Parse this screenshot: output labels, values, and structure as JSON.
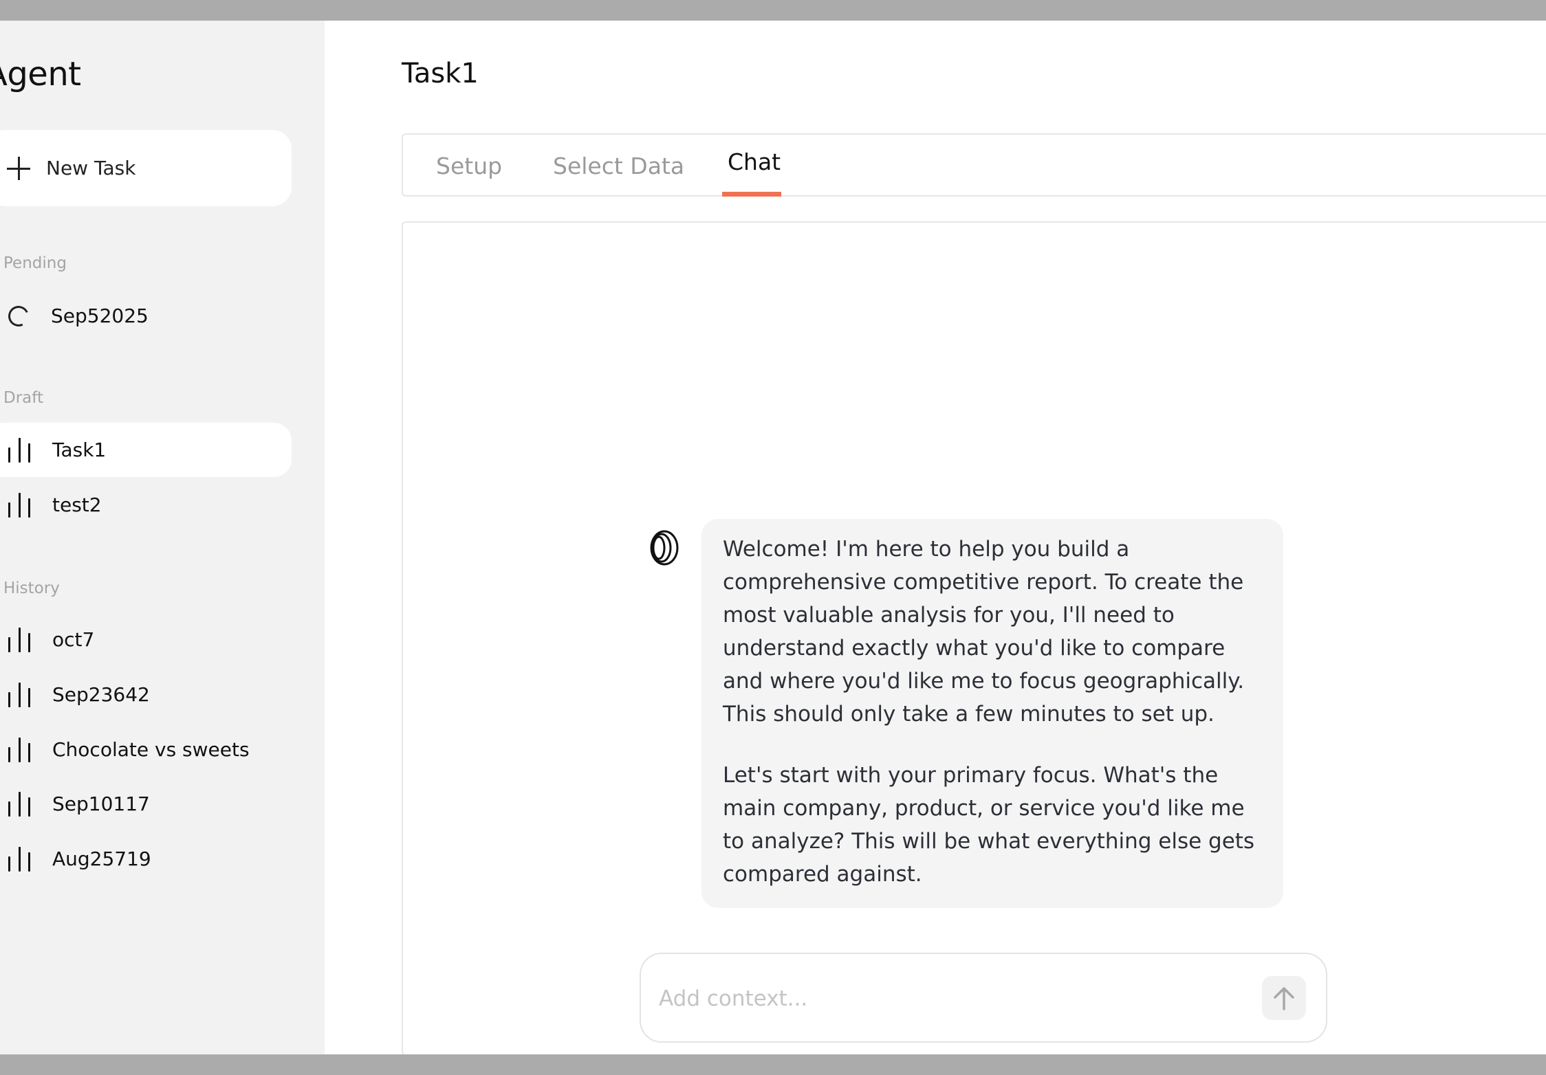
{
  "sidebar": {
    "brand": "Agent",
    "new_task_label": "New Task",
    "sections": {
      "pending": "Pending",
      "draft": "Draft",
      "history": "History"
    },
    "pending_items": [
      {
        "label": "Sep52025",
        "icon": "spinner-icon"
      }
    ],
    "draft_items": [
      {
        "label": "Task1",
        "icon": "bar-chart-icon",
        "active": true
      },
      {
        "label": "test2",
        "icon": "bar-chart-icon"
      }
    ],
    "history_items": [
      {
        "label": "oct7",
        "icon": "bar-chart-icon"
      },
      {
        "label": "Sep23642",
        "icon": "bar-chart-icon"
      },
      {
        "label": "Chocolate vs sweets",
        "icon": "bar-chart-icon"
      },
      {
        "label": "Sep10117",
        "icon": "bar-chart-icon"
      },
      {
        "label": "Aug25719",
        "icon": "bar-chart-icon"
      }
    ]
  },
  "main": {
    "title": "Task1",
    "tabs": [
      {
        "label": "Setup"
      },
      {
        "label": "Select Data"
      },
      {
        "label": "Chat",
        "active": true
      }
    ],
    "chat": {
      "messages": [
        {
          "role": "assistant",
          "paragraphs": [
            "Welcome! I'm here to help you build a comprehensive competitive report. To create the most valuable analysis for you, I'll need to understand exactly what you'd like to compare and where you'd like me to focus geographically. This should only take a few minutes to set up.",
            "Let's start with your primary focus. What's the main company, product, or service you'd like me to analyze? This will be what everything else gets compared against."
          ]
        }
      ],
      "composer": {
        "placeholder": "Add context...",
        "value": ""
      }
    }
  },
  "colors": {
    "accent": "#f07152",
    "sidebar_bg": "#f2f2f2",
    "bubble_bg": "#f4f4f4"
  }
}
